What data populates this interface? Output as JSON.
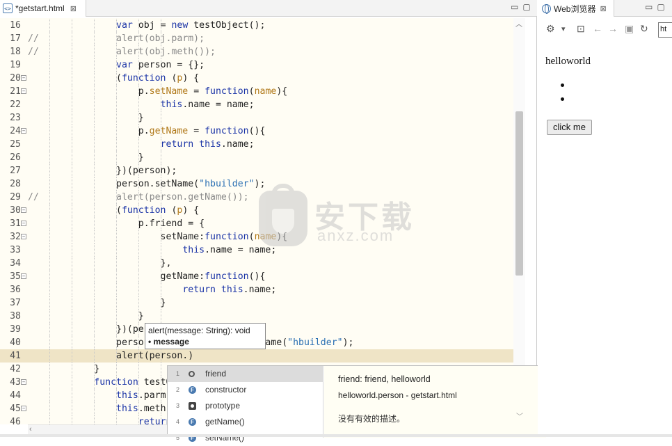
{
  "editor": {
    "tab_label": "*getstart.html",
    "tab_close": "⊠",
    "tab_icon": "html-file-icon",
    "window_controls": "▭▢",
    "lines": [
      {
        "n": "16",
        "fold": false,
        "comment": false,
        "current": false,
        "html": "                <span class=\"k\">var</span> obj = <span class=\"k\">new</span> testObject();"
      },
      {
        "n": "17",
        "fold": false,
        "comment": true,
        "current": false,
        "html": "<span class=\"cm\">//              alert(obj.parm);</span>"
      },
      {
        "n": "18",
        "fold": false,
        "comment": true,
        "current": false,
        "html": "<span class=\"cm\">//              alert(obj.meth());</span>"
      },
      {
        "n": "19",
        "fold": false,
        "comment": false,
        "current": false,
        "html": "                <span class=\"k\">var</span> person = {};"
      },
      {
        "n": "20",
        "fold": true,
        "comment": false,
        "current": false,
        "html": "                (<span class=\"k\">function</span> (<span class=\"fn\">p</span>) {"
      },
      {
        "n": "21",
        "fold": true,
        "comment": false,
        "current": false,
        "html": "                    p.<span class=\"fn\">setName</span> = <span class=\"k\">function</span>(<span class=\"fn\">name</span>){"
      },
      {
        "n": "22",
        "fold": false,
        "comment": false,
        "current": false,
        "html": "                        <span class=\"k\">this</span>.name = name;"
      },
      {
        "n": "23",
        "fold": false,
        "comment": false,
        "current": false,
        "html": "                    }"
      },
      {
        "n": "24",
        "fold": true,
        "comment": false,
        "current": false,
        "html": "                    p.<span class=\"fn\">getName</span> = <span class=\"k\">function</span>(){"
      },
      {
        "n": "25",
        "fold": false,
        "comment": false,
        "current": false,
        "html": "                        <span class=\"k\">return</span> <span class=\"k\">this</span>.name;"
      },
      {
        "n": "26",
        "fold": false,
        "comment": false,
        "current": false,
        "html": "                    }"
      },
      {
        "n": "27",
        "fold": false,
        "comment": false,
        "current": false,
        "html": "                })(person);"
      },
      {
        "n": "28",
        "fold": false,
        "comment": false,
        "current": false,
        "html": "                person.setName(<span class=\"str\">\"hbuilder\"</span>);"
      },
      {
        "n": "29",
        "fold": false,
        "comment": true,
        "current": false,
        "html": "<span class=\"cm\">//              alert(person.getName());</span>"
      },
      {
        "n": "30",
        "fold": true,
        "comment": false,
        "current": false,
        "html": "                (<span class=\"k\">function</span> (<span class=\"fn\">p</span>) {"
      },
      {
        "n": "31",
        "fold": true,
        "comment": false,
        "current": false,
        "html": "                    p.friend = {"
      },
      {
        "n": "32",
        "fold": true,
        "comment": false,
        "current": false,
        "html": "                        setName:<span class=\"k\">function</span>(<span class=\"fn\">name</span>){"
      },
      {
        "n": "33",
        "fold": false,
        "comment": false,
        "current": false,
        "html": "                            <span class=\"k\">this</span>.name = name;"
      },
      {
        "n": "34",
        "fold": false,
        "comment": false,
        "current": false,
        "html": "                        },"
      },
      {
        "n": "35",
        "fold": true,
        "comment": false,
        "current": false,
        "html": "                        getName:<span class=\"k\">function</span>(){"
      },
      {
        "n": "36",
        "fold": false,
        "comment": false,
        "current": false,
        "html": "                            <span class=\"k\">return</span> <span class=\"k\">this</span>.name;"
      },
      {
        "n": "37",
        "fold": false,
        "comment": false,
        "current": false,
        "html": "                        }"
      },
      {
        "n": "38",
        "fold": false,
        "comment": false,
        "current": false,
        "html": "                    }"
      },
      {
        "n": "39",
        "fold": false,
        "comment": false,
        "current": false,
        "html": "                })(pe"
      },
      {
        "n": "40",
        "fold": false,
        "comment": false,
        "current": false,
        "html": "                perso                  setName(<span class=\"str\">\"hbuilder\"</span>);"
      },
      {
        "n": "41",
        "fold": false,
        "comment": false,
        "current": true,
        "html": "                alert(person.)"
      },
      {
        "n": "42",
        "fold": false,
        "comment": false,
        "current": false,
        "html": "            }"
      },
      {
        "n": "43",
        "fold": true,
        "comment": false,
        "current": false,
        "html": "            <span class=\"k\">function</span> testO"
      },
      {
        "n": "44",
        "fold": false,
        "comment": false,
        "current": false,
        "html": "                <span class=\"k\">this</span>.parm"
      },
      {
        "n": "45",
        "fold": true,
        "comment": false,
        "current": false,
        "html": "                <span class=\"k\">this</span>.meth"
      },
      {
        "n": "46",
        "fold": false,
        "comment": false,
        "current": false,
        "html": "                    <span class=\"k\">return</span>"
      }
    ]
  },
  "tooltip": {
    "line1": "alert(message: String): void",
    "line2": "• message"
  },
  "autocomplete": {
    "items": [
      {
        "num": "1",
        "icon": "property-icon",
        "label": "friend",
        "selected": true
      },
      {
        "num": "2",
        "icon": "function-icon",
        "label": "constructor",
        "selected": false
      },
      {
        "num": "3",
        "icon": "object-icon",
        "label": "prototype",
        "selected": false
      },
      {
        "num": "4",
        "icon": "function-icon",
        "label": "getName()",
        "selected": false
      },
      {
        "num": "5",
        "icon": "function-icon",
        "label": "setName()",
        "selected": false
      }
    ],
    "detail_title": "friend: friend, helloworld",
    "detail_source": "helloworld.person - getstart.html",
    "detail_desc": "没有有效的描述。"
  },
  "watermark": {
    "cn": "安下载",
    "en": "anxz.com"
  },
  "browser": {
    "tab_label": "Web浏览器",
    "tab_close": "⊠",
    "window_controls": "▭▢",
    "toolbar": {
      "settings_icon": "⚙",
      "dropdown_icon": "▾",
      "console_icon": "⊡",
      "back_icon": "←",
      "forward_icon": "→",
      "stop_icon": "▣",
      "refresh_icon": "↻"
    },
    "url_value": "ht",
    "page_heading": "helloworld",
    "button_label": "click me"
  }
}
